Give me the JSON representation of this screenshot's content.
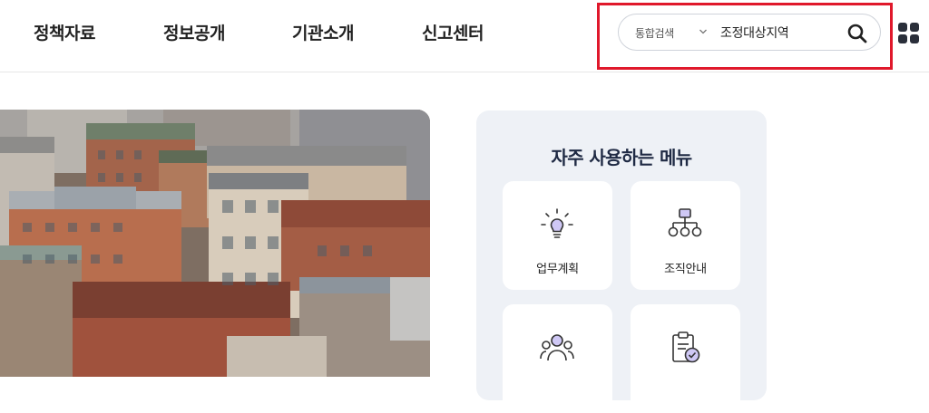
{
  "header": {
    "nav": [
      "정책자료",
      "정보공개",
      "기관소개",
      "신고센터"
    ],
    "search": {
      "scope": "통합검색",
      "query": "조정대상지역"
    }
  },
  "quick_menu": {
    "title": "자주 사용하는 메뉴",
    "items": [
      {
        "label": "업무계획",
        "icon": "lightbulb-icon"
      },
      {
        "label": "조직안내",
        "icon": "org-chart-icon"
      },
      {
        "label": "",
        "icon": "people-icon"
      },
      {
        "label": "",
        "icon": "clipboard-check-icon"
      }
    ]
  },
  "colors": {
    "accent_purple": "#6b5bd6",
    "highlight_red": "#e0182b",
    "panel_bg": "#eef1f6",
    "title_navy": "#1f2a44"
  }
}
